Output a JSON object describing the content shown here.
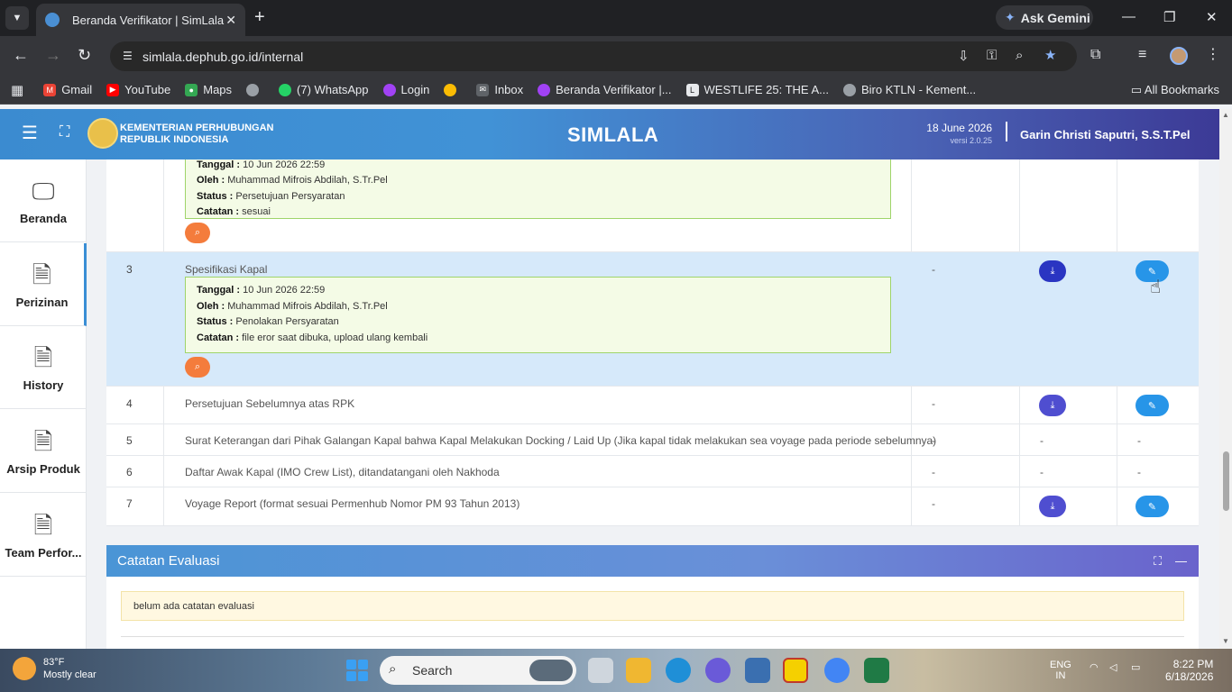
{
  "browser": {
    "tab_title": "Beranda Verifikator | SimLala",
    "tab_close": "✕",
    "new_tab": "+",
    "ask_gemini": "Ask Gemini",
    "url": "simlala.dephub.go.id/internal",
    "bookmarks": [
      {
        "label": "Gmail",
        "color": "#ea4335"
      },
      {
        "label": "YouTube",
        "color": "#ff0000"
      },
      {
        "label": "Maps",
        "color": "#34a853"
      },
      {
        "label": "",
        "color": "#9aa0a6"
      },
      {
        "label": "(7) WhatsApp",
        "color": "#25d366"
      },
      {
        "label": "Login",
        "color": "#a142f4"
      },
      {
        "label": "",
        "color": "#fbbc04"
      },
      {
        "label": "Inbox",
        "color": "#bdc1c6"
      },
      {
        "label": "Beranda Verifikator |...",
        "color": "#a142f4"
      },
      {
        "label": "WESTLIFE 25: THE A...",
        "color": "#e8eaed"
      },
      {
        "label": "Biro KTLN - Kement...",
        "color": "#9aa0a6"
      }
    ],
    "all_bookmarks": "All Bookmarks"
  },
  "header": {
    "org_line1": "KEMENTERIAN PERHUBUNGAN",
    "org_line2": "REPUBLIK INDONESIA",
    "brand": "SIMLALA",
    "date": "18 June 2026",
    "version": "versi 2.0.25",
    "user": "Garin Christi Saputri, S.S.T.Pel"
  },
  "sidebar": {
    "items": [
      {
        "label": "Beranda",
        "icon": "monitor-icon"
      },
      {
        "label": "Perizinan",
        "icon": "document-icon"
      },
      {
        "label": "History",
        "icon": "document-icon"
      },
      {
        "label": "Arsip Produk",
        "icon": "document-icon"
      },
      {
        "label": "Team Perfor...",
        "icon": "document-icon"
      }
    ]
  },
  "table": {
    "row2_note": {
      "tanggal_label": "Tanggal :",
      "tanggal": "10 Jun 2026 22:59",
      "oleh_label": "Oleh :",
      "oleh": "Muhammad Mifrois Abdilah, S.Tr.Pel",
      "status_label": "Status :",
      "status": "Persetujuan Persyaratan",
      "catatan_label": "Catatan :",
      "catatan": "sesuai"
    },
    "rows": [
      {
        "no": "3",
        "name": "Spesifikasi Kapal",
        "note": {
          "tanggal": "10 Jun 2026 22:59",
          "oleh": "Muhammad Mifrois Abdilah, S.Tr.Pel",
          "status": "Penolakan Persyaratan",
          "catatan": "file eror saat dibuka, upload ulang kembali"
        },
        "keterangan": "-"
      },
      {
        "no": "4",
        "name": "Persetujuan Sebelumnya atas RPK",
        "keterangan": "-"
      },
      {
        "no": "5",
        "name": "Surat Keterangan dari Pihak Galangan Kapal bahwa Kapal Melakukan Docking / Laid Up (Jika kapal tidak melakukan sea voyage pada periode sebelumnya)",
        "keterangan": "-",
        "download": "-",
        "edit": "-"
      },
      {
        "no": "6",
        "name": "Daftar Awak Kapal (IMO Crew List), ditandatangani oleh Nakhoda",
        "keterangan": "-",
        "download": "-",
        "edit": "-"
      },
      {
        "no": "7",
        "name": "Voyage Report (format sesuai Permenhub Nomor PM 93 Tahun 2013)",
        "keterangan": "-"
      }
    ]
  },
  "evaluasi": {
    "title": "Catatan Evaluasi",
    "message": "belum ada catatan evaluasi"
  },
  "taskbar": {
    "temp": "83°F",
    "weather": "Mostly clear",
    "search": "Search",
    "lang1": "ENG",
    "lang2": "IN",
    "time": "8:22 PM",
    "date": "6/18/2026"
  }
}
